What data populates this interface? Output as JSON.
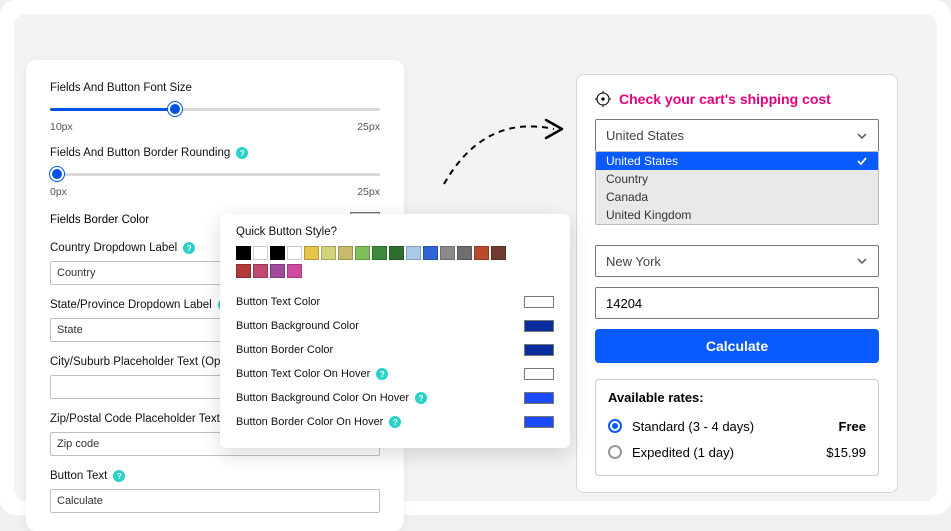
{
  "left": {
    "fontSize": {
      "label": "Fields And Button Font Size",
      "min": "10px",
      "max": "25px",
      "pct": 38
    },
    "borderRounding": {
      "label": "Fields And Button Border Rounding",
      "min": "0px",
      "max": "25px",
      "pct": 2
    },
    "borderColor": {
      "label": "Fields Border Color",
      "value": "#cccccc"
    },
    "countryLabel": {
      "label": "Country Dropdown Label",
      "value": "Country"
    },
    "stateLabel": {
      "label": "State/Province Dropdown Label",
      "value": "State"
    },
    "cityPlaceholder": {
      "label": "City/Suburb Placeholder Text (Optional!)",
      "value": ""
    },
    "zipPlaceholder": {
      "label": "Zip/Postal Code Placeholder Text",
      "value": "Zip code"
    },
    "buttonText": {
      "label": "Button Text",
      "value": "Calculate"
    }
  },
  "popup": {
    "title": "Quick Button Style?",
    "row1": [
      "#000000",
      "#ffffff",
      "#000000",
      "#ffffff",
      "#e6c44b",
      "#d1d17a",
      "#c9b96a",
      "#7fbf5a",
      "#3a8a3a",
      "#2f6e2f",
      "#a9c9e8",
      "#2f63d6",
      "#8a8a8a",
      "#6e6e6e",
      "#b84a2e",
      "#6e3b2e"
    ],
    "row2": [
      "#b23a3a",
      "#c1486e",
      "#a14a9e",
      "#d14aa1"
    ],
    "rows": [
      {
        "label": "Button Text Color",
        "help": false,
        "value": "#ffffff"
      },
      {
        "label": "Button Background Color",
        "help": false,
        "value": "#0a2e9e"
      },
      {
        "label": "Button Border Color",
        "help": false,
        "value": "#0a2e9e"
      },
      {
        "label": "Button Text Color On Hover",
        "help": true,
        "value": "#ffffff"
      },
      {
        "label": "Button Background Color On Hover",
        "help": true,
        "value": "#1e4bff"
      },
      {
        "label": "Button Border Color On Hover",
        "help": true,
        "value": "#1e4bff"
      }
    ]
  },
  "right": {
    "title": "Check your cart's shipping cost",
    "countryValue": "United States",
    "countryOptions": [
      "United States",
      "Country",
      "Canada",
      "United Kingdom"
    ],
    "stateValue": "New York",
    "zipValue": "14204",
    "calcLabel": "Calculate",
    "ratesTitle": "Available rates:",
    "rates": [
      {
        "name": "Standard (3 - 4 days)",
        "price": "Free",
        "selected": true
      },
      {
        "name": "Expedited (1 day)",
        "price": "$15.99",
        "selected": false
      }
    ]
  }
}
